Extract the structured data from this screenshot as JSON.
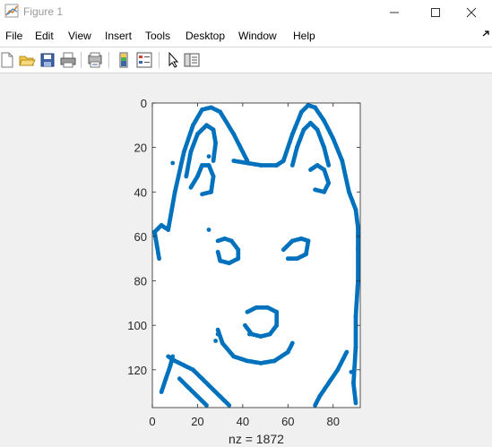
{
  "window": {
    "title": "Figure 1",
    "minimize_icon": "minimize-icon",
    "maximize_icon": "maximize-icon",
    "close_icon": "close-icon"
  },
  "menu": {
    "items": [
      "File",
      "Edit",
      "View",
      "Insert",
      "Tools",
      "Desktop",
      "Window",
      "Help"
    ]
  },
  "toolbar": {
    "buttons": [
      "new-figure-icon",
      "open-file-icon",
      "save-icon",
      "print-icon",
      "print-preview-icon",
      "insert-colorbar-icon",
      "insert-legend-icon",
      "edit-plot-icon",
      "property-inspector-icon"
    ]
  },
  "colors": {
    "marker": "#0072bd",
    "background": "#f0f0f0",
    "axes_background": "#ffffff"
  },
  "chart_data": {
    "type": "scatter",
    "xlabel": "nz = 1872",
    "ylabel": "",
    "title": "",
    "xlim": [
      0,
      92
    ],
    "ylim": [
      0,
      137
    ],
    "y_reversed": true,
    "xticks": [
      0,
      20,
      40,
      60,
      80
    ],
    "yticks": [
      0,
      20,
      40,
      60,
      80,
      100,
      120
    ],
    "grid": false,
    "description_points_shape": "husky-dog-face-outline",
    "nz": 1872,
    "strokes": [
      {
        "name": "left-ear-outer",
        "points": [
          [
            7,
            57
          ],
          [
            10,
            40
          ],
          [
            14,
            22
          ],
          [
            18,
            10
          ],
          [
            22,
            3
          ],
          [
            26,
            2
          ],
          [
            30,
            4
          ],
          [
            36,
            14
          ],
          [
            40,
            22
          ],
          [
            42,
            26
          ]
        ]
      },
      {
        "name": "left-ear-inner",
        "points": [
          [
            15,
            33
          ],
          [
            17,
            22
          ],
          [
            20,
            14
          ],
          [
            24,
            10
          ],
          [
            27,
            12
          ],
          [
            28,
            18
          ],
          [
            27,
            26
          ]
        ]
      },
      {
        "name": "left-ear-fill",
        "points": [
          [
            17,
            38
          ],
          [
            20,
            33
          ],
          [
            22,
            28
          ],
          [
            25,
            28
          ],
          [
            27,
            33
          ],
          [
            26,
            40
          ],
          [
            22,
            41
          ]
        ]
      },
      {
        "name": "head-top",
        "points": [
          [
            36,
            26
          ],
          [
            42,
            27
          ],
          [
            48,
            28
          ],
          [
            55,
            28
          ],
          [
            58,
            26
          ]
        ]
      },
      {
        "name": "right-ear-outer",
        "points": [
          [
            58,
            26
          ],
          [
            62,
            14
          ],
          [
            66,
            4
          ],
          [
            69,
            1
          ],
          [
            72,
            2
          ],
          [
            76,
            8
          ],
          [
            80,
            16
          ],
          [
            84,
            26
          ],
          [
            87,
            40
          ],
          [
            90,
            48
          ]
        ]
      },
      {
        "name": "right-ear-inner",
        "points": [
          [
            62,
            28
          ],
          [
            64,
            20
          ],
          [
            67,
            12
          ],
          [
            70,
            9
          ],
          [
            73,
            12
          ],
          [
            76,
            20
          ],
          [
            78,
            28
          ]
        ]
      },
      {
        "name": "right-ear-fill",
        "points": [
          [
            70,
            30
          ],
          [
            73,
            28
          ],
          [
            76,
            30
          ],
          [
            78,
            36
          ],
          [
            76,
            40
          ],
          [
            72,
            39
          ]
        ]
      },
      {
        "name": "left-cheek",
        "points": [
          [
            7,
            57
          ],
          [
            4,
            55
          ],
          [
            1,
            58
          ],
          [
            2,
            64
          ],
          [
            3,
            70
          ]
        ]
      },
      {
        "name": "right-cheek",
        "points": [
          [
            90,
            48
          ],
          [
            91,
            56
          ],
          [
            91,
            66
          ],
          [
            91,
            80
          ],
          [
            90,
            96
          ],
          [
            90,
            110
          ],
          [
            89,
            126
          ],
          [
            90,
            135
          ]
        ]
      },
      {
        "name": "left-eye",
        "points": [
          [
            29,
            62
          ],
          [
            32,
            61
          ],
          [
            35,
            62
          ],
          [
            38,
            66
          ],
          [
            38,
            70
          ],
          [
            34,
            72
          ],
          [
            30,
            71
          ],
          [
            29,
            67
          ]
        ]
      },
      {
        "name": "right-eye",
        "points": [
          [
            58,
            66
          ],
          [
            62,
            62
          ],
          [
            66,
            61
          ],
          [
            69,
            62
          ],
          [
            68,
            68
          ],
          [
            64,
            70
          ],
          [
            60,
            70
          ]
        ]
      },
      {
        "name": "nose",
        "points": [
          [
            42,
            94
          ],
          [
            46,
            92
          ],
          [
            51,
            92
          ],
          [
            55,
            94
          ],
          [
            55,
            100
          ],
          [
            52,
            104
          ],
          [
            48,
            105
          ],
          [
            44,
            104
          ],
          [
            41,
            100
          ]
        ]
      },
      {
        "name": "mouth",
        "points": [
          [
            29,
            102
          ],
          [
            31,
            108
          ],
          [
            36,
            114
          ],
          [
            42,
            116
          ],
          [
            48,
            117
          ],
          [
            54,
            116
          ],
          [
            60,
            112
          ],
          [
            62,
            108
          ]
        ]
      },
      {
        "name": "chin-left",
        "points": [
          [
            7,
            114
          ],
          [
            10,
            116
          ],
          [
            14,
            118
          ],
          [
            18,
            120
          ],
          [
            22,
            124
          ],
          [
            26,
            128
          ],
          [
            30,
            132
          ],
          [
            34,
            136
          ]
        ]
      },
      {
        "name": "chin-right",
        "points": [
          [
            86,
            112
          ],
          [
            82,
            120
          ],
          [
            78,
            126
          ],
          [
            74,
            132
          ],
          [
            72,
            136
          ]
        ]
      },
      {
        "name": "collar-left",
        "points": [
          [
            12,
            124
          ],
          [
            16,
            128
          ],
          [
            20,
            132
          ],
          [
            24,
            136
          ]
        ]
      },
      {
        "name": "left-jaw",
        "points": [
          [
            4,
            130
          ],
          [
            6,
            124
          ],
          [
            8,
            118
          ],
          [
            9,
            114
          ]
        ]
      }
    ],
    "stray_points": [
      [
        25,
        24
      ],
      [
        9,
        27
      ],
      [
        25,
        57
      ],
      [
        43,
        104
      ],
      [
        29,
        104
      ],
      [
        28,
        107
      ],
      [
        88,
        121
      ]
    ]
  }
}
